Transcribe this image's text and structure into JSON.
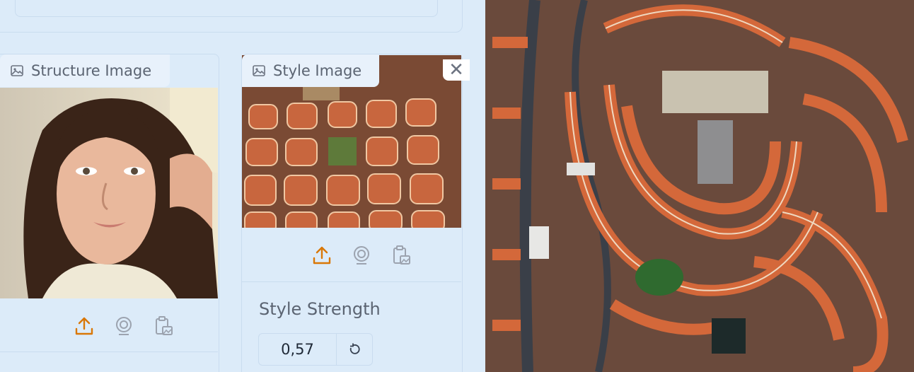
{
  "structure_panel": {
    "label": "Structure Image"
  },
  "style_panel": {
    "label": "Style Image",
    "close_glyph": "✕"
  },
  "style_strength": {
    "label": "Style Strength",
    "value": "0,57"
  },
  "icons": {
    "upload": "upload-icon",
    "webcam": "webcam-icon",
    "clipboard": "clipboard-image-icon",
    "image": "image-icon",
    "reset": "reset-icon"
  },
  "colors": {
    "accent": "#d97706",
    "panel_bg": "#dcebf9",
    "border": "#c9dcef"
  }
}
